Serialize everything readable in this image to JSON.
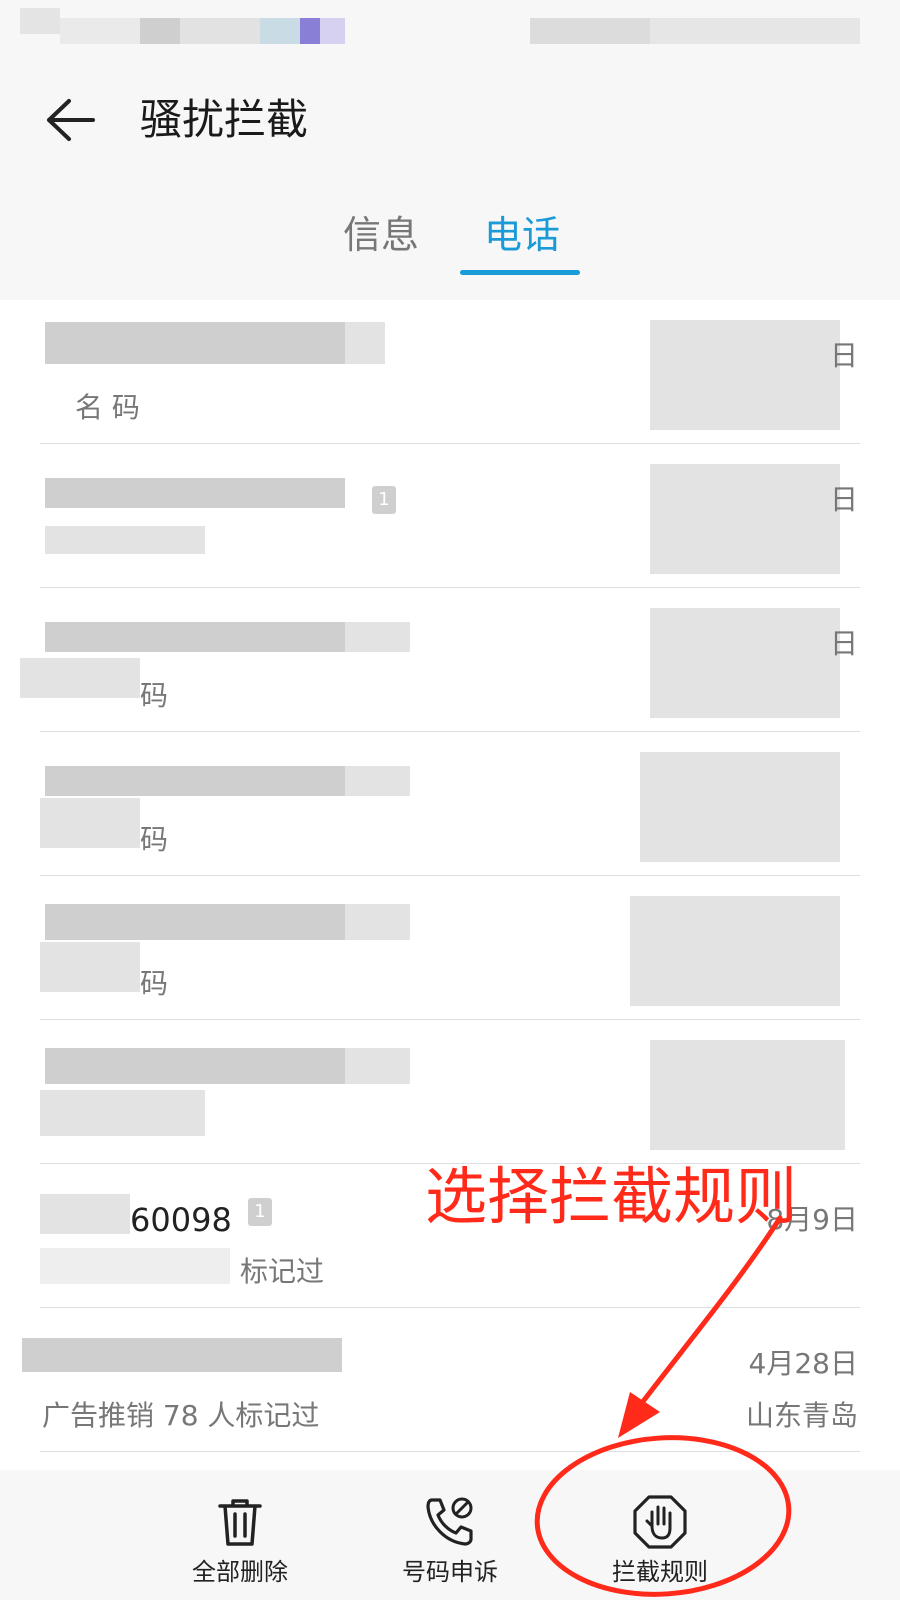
{
  "header": {
    "title": "骚扰拦截",
    "back_label": "back"
  },
  "tabs": [
    {
      "label": "信息",
      "active": false
    },
    {
      "label": "电话",
      "active": true
    }
  ],
  "accent_color": "#1a9bd7",
  "calls": [
    {
      "primary": "",
      "secondary": "名 码",
      "date": "日",
      "location": ""
    },
    {
      "primary": "",
      "secondary": "",
      "date": "日",
      "location": ""
    },
    {
      "primary": "",
      "secondary": "码",
      "date": "日",
      "location": ""
    },
    {
      "primary": "",
      "secondary": "码",
      "date": "",
      "location": ""
    },
    {
      "primary": "",
      "secondary": "码",
      "date": "",
      "location": ""
    },
    {
      "primary": "",
      "secondary": "",
      "date": "",
      "location": ""
    },
    {
      "primary": "60098",
      "secondary": "标记过",
      "date": "8月9日",
      "location": ""
    },
    {
      "primary": "",
      "secondary": "广告推销  78 人标记过",
      "date": "4月28日",
      "location": "山东青岛"
    }
  ],
  "sim_badge": "1",
  "annotation": {
    "text": "选择拦截规则",
    "color": "#ff2a1a"
  },
  "toolbar": {
    "delete_all": "全部删除",
    "appeal": "号码申诉",
    "rules": "拦截规则"
  },
  "icons": {
    "back": "arrow-left-icon",
    "delete": "trash-icon",
    "appeal": "phone-blocked-icon",
    "rules": "hand-stop-icon"
  }
}
